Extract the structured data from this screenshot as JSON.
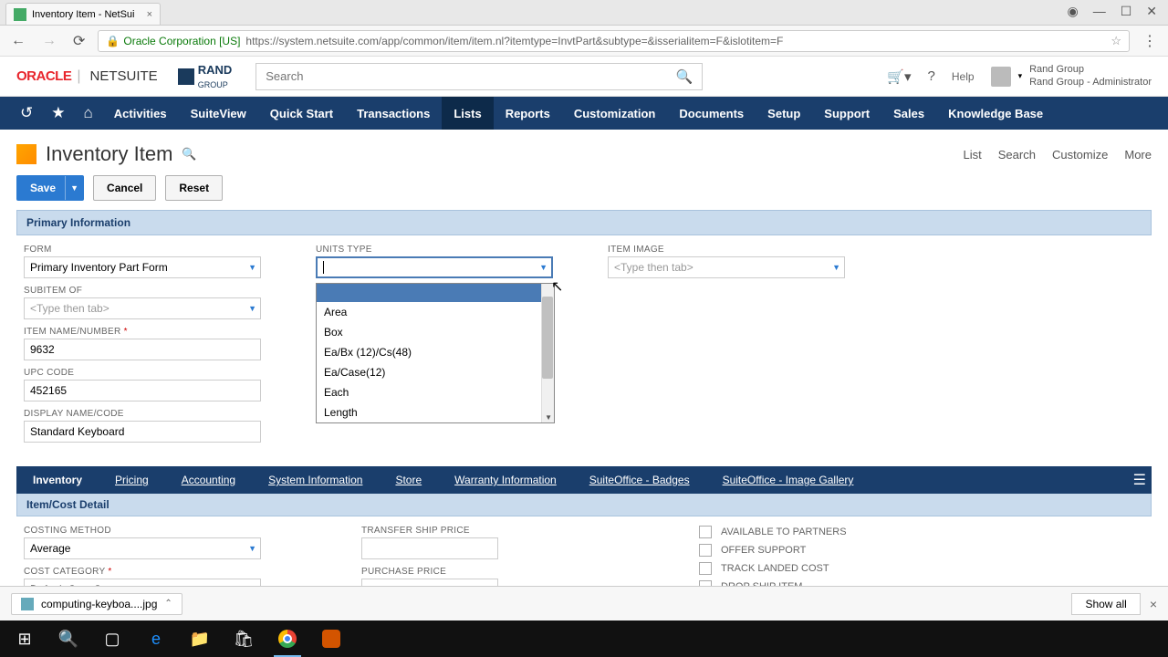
{
  "browser": {
    "tab_title": "Inventory Item - NetSui",
    "url_org": "Oracle Corporation [US]",
    "url": "https://system.netsuite.com/app/common/item/item.nl?itemtype=InvtPart&subtype=&isserialitem=F&islotitem=F"
  },
  "header": {
    "oracle": "ORACLE",
    "netsuite": "NETSUITE",
    "rand": "RAND",
    "rand_sub": "GROUP",
    "search_placeholder": "Search",
    "help": "Help",
    "user_name": "Rand Group",
    "user_role": "Rand Group - Administrator"
  },
  "menu": [
    "Activities",
    "SuiteView",
    "Quick Start",
    "Transactions",
    "Lists",
    "Reports",
    "Customization",
    "Documents",
    "Setup",
    "Support",
    "Sales",
    "Knowledge Base"
  ],
  "page": {
    "title": "Inventory Item",
    "actions": [
      "List",
      "Search",
      "Customize",
      "More"
    ]
  },
  "buttons": {
    "save": "Save",
    "cancel": "Cancel",
    "reset": "Reset"
  },
  "section_primary": "Primary Information",
  "fields": {
    "form_label": "FORM",
    "form_value": "Primary Inventory Part Form",
    "subitem_label": "SUBITEM OF",
    "subitem_placeholder": "<Type then tab>",
    "itemname_label": "ITEM NAME/NUMBER",
    "itemname_value": "9632",
    "upc_label": "UPC CODE",
    "upc_value": "452165",
    "display_label": "DISPLAY NAME/CODE",
    "display_value": "Standard Keyboard",
    "units_label": "UNITS TYPE",
    "image_label": "ITEM IMAGE",
    "image_placeholder": "<Type then tab>"
  },
  "units_options": [
    "Area",
    "Box",
    "Ea/Bx (12)/Cs(48)",
    "Ea/Case(12)",
    "Each",
    "Length"
  ],
  "tabs": [
    "Inventory",
    "Pricing",
    "Accounting",
    "System Information",
    "Store",
    "Warranty Information",
    "SuiteOffice - Badges",
    "SuiteOffice - Image Gallery"
  ],
  "sub_section": "Item/Cost Detail",
  "detail": {
    "costing_label": "COSTING METHOD",
    "costing_value": "Average",
    "costcat_label": "COST CATEGORY",
    "costcat_value": "Default Cost Category",
    "transfer_label": "TRANSFER SHIP PRICE",
    "purchase_label": "PURCHASE PRICE",
    "checks": [
      "AVAILABLE TO PARTNERS",
      "OFFER SUPPORT",
      "TRACK LANDED COST",
      "DROP SHIP ITEM"
    ]
  },
  "download": {
    "file": "computing-keyboa....jpg",
    "showall": "Show all"
  }
}
